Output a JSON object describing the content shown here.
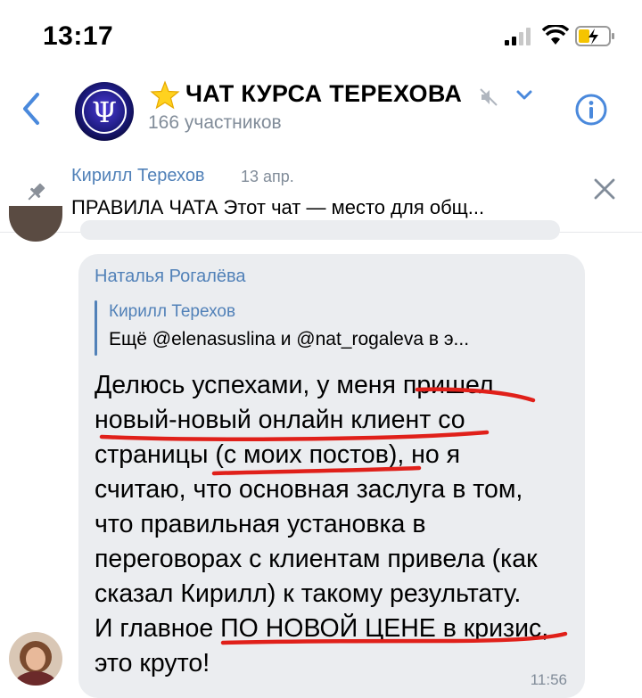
{
  "status": {
    "time": "13:17"
  },
  "header": {
    "title": "ЧАТ КУРСА ТЕРЕХОВА",
    "subtitle": "166 участников",
    "accent": "#5181b8"
  },
  "pinned": {
    "author": "Кирилл Терехов",
    "date": "13 апр.",
    "text": "ПРАВИЛА ЧАТА Этот чат — место для общ..."
  },
  "message": {
    "author": "Наталья Рогалёва",
    "reply": {
      "author": "Кирилл Терехов",
      "text": "Ещё @elenasuslina и @nat_rogaleva в э..."
    },
    "lines": [
      "Делюсь успехами, у меня пришел",
      "новый-новый онлайн клиент со",
      "страницы (с моих постов), но я",
      "считаю, что основная заслуга в том,",
      "что правильная установка в",
      "переговорах с клиентам привела (как",
      "сказал Кирилл) к такому результату.",
      "И главное ПО НОВОЙ ЦЕНЕ в кризис,",
      "это круто!"
    ],
    "time": "11:56"
  }
}
